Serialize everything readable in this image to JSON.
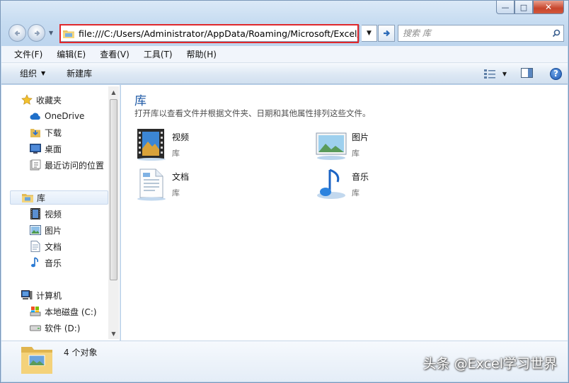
{
  "window": {
    "minimize_glyph": "—",
    "maximize_glyph": "□",
    "close_glyph": "✕"
  },
  "address": {
    "path": "file:///C:/Users/Administrator/AppData/Roaming/Microsoft/Excel/",
    "highlight_color": "#e0282c"
  },
  "search": {
    "placeholder": "搜索 库"
  },
  "menu": {
    "items": [
      "文件(F)",
      "编辑(E)",
      "查看(V)",
      "工具(T)",
      "帮助(H)"
    ]
  },
  "command_bar": {
    "organize_label": "组织",
    "new_library_label": "新建库",
    "help_label": "?"
  },
  "nav_pane": {
    "favorites": {
      "label": "收藏夹",
      "items": [
        "OneDrive",
        "下载",
        "桌面",
        "最近访问的位置"
      ]
    },
    "libraries": {
      "label": "库",
      "items": [
        "视频",
        "图片",
        "文档",
        "音乐"
      ]
    },
    "computer": {
      "label": "计算机",
      "items": [
        "本地磁盘 (C:)",
        "软件 (D:)"
      ]
    }
  },
  "content": {
    "title": "库",
    "description": "打开库以查看文件并根据文件夹、日期和其他属性排列这些文件。",
    "libraries": [
      {
        "name": "视频",
        "type": "库",
        "icon": "video-library-icon"
      },
      {
        "name": "图片",
        "type": "库",
        "icon": "pictures-library-icon"
      },
      {
        "name": "文档",
        "type": "库",
        "icon": "documents-library-icon"
      },
      {
        "name": "音乐",
        "type": "库",
        "icon": "music-library-icon"
      }
    ]
  },
  "details": {
    "count": "4 个对象"
  },
  "watermark": "头条 @Excel学习世界",
  "colors": {
    "accent_title": "#1f5aa6",
    "selection": "#e1ecf9",
    "close_button": "#c7452c"
  }
}
